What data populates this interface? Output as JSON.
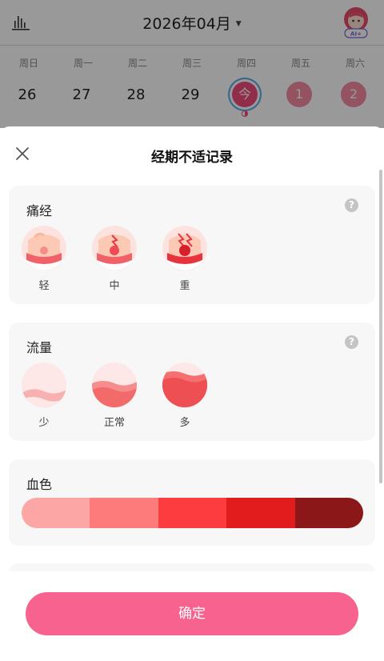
{
  "calendar": {
    "month_title": "2026年04月",
    "weekdays": [
      "周日",
      "周一",
      "周二",
      "周三",
      "周四",
      "周五",
      "周六"
    ],
    "days": [
      "26",
      "27",
      "28",
      "29",
      "今",
      "1",
      "2"
    ],
    "avatar_badge": "AI+"
  },
  "sheet": {
    "title": "经期不适记录",
    "cramps": {
      "title": "痛经",
      "help": "?",
      "options": [
        "轻",
        "中",
        "重"
      ]
    },
    "flow": {
      "title": "流量",
      "help": "?",
      "options": [
        "少",
        "正常",
        "多"
      ]
    },
    "blood_color": {
      "title": "血色",
      "swatches": [
        "#fda6a6",
        "#fd7b7b",
        "#fd3c3f",
        "#e21b1d",
        "#8b1719"
      ]
    },
    "confirm_label": "确定"
  },
  "colors": {
    "accent": "#f8628f",
    "today": "#f04b7d",
    "period_day": "#f58aa2"
  }
}
